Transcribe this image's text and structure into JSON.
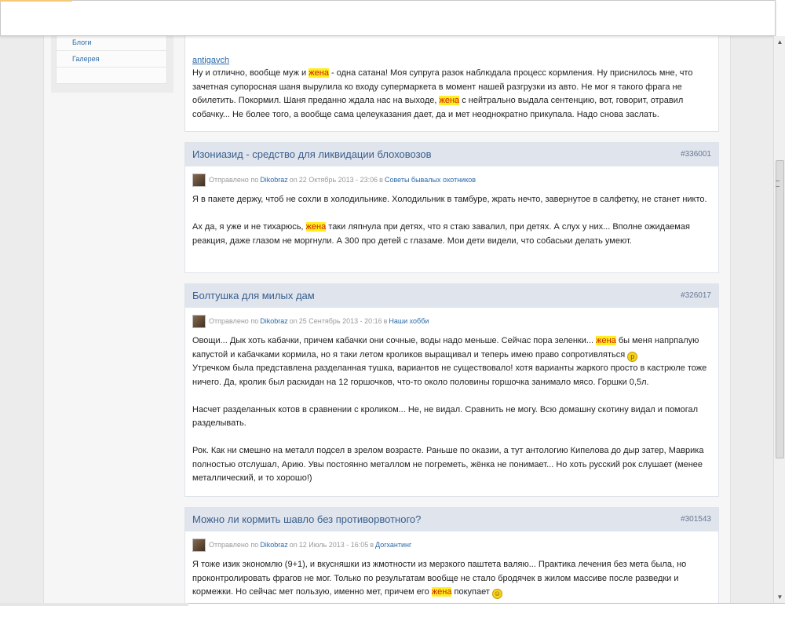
{
  "sidebar": {
    "items": [
      {
        "label": "Блоги"
      },
      {
        "label": "Галерея"
      }
    ]
  },
  "previous_post": {
    "author": "antigavch",
    "text_parts": [
      "Ну и отлично, вообще муж и ",
      "жена",
      " - одна сатана! Моя супруга разок наблюдала процесс кормления. Ну приснилось мне, что зачетная супоросная шаня вырулила ко входу супермаркета в момент нашей разгрузки из авто. Не мог я такого фрага не обилетить. Покормил. Шаня преданно ждала нас на выходе, ",
      "жена",
      " с нейтрально выдала сентенцию, вот, говорит, отравил собачку... Не более того, а вообще сама целеуказания дает, да и мет неоднократно прикупала. Надо снова заслать."
    ]
  },
  "posts": [
    {
      "title": "Изониазид - средство для ликвидации блоховозов",
      "id": "#336001",
      "meta_sent": "Отправлено по",
      "author": "Dikobraz",
      "meta_on": "on",
      "date": "22 Октябрь 2013 - 23:06",
      "meta_in": "в",
      "forum": "Советы бывалых охотников",
      "p1": "Я в пакете держу, чтоб не сохли в холодильнике. Холодильник в тамбуре, жрать нечто, завернутое в салфетку, не станет никто.",
      "p2_a": "Ах да, я уже и не тихарюсь, ",
      "p2_hl": "жена",
      "p2_b": " таки ляпнула при детях, что я стаю завалил, при детях. А слух у них... Вполне ожидаемая реакция, даже глазом не моргнули. А 300 про детей с глазаме. Мои дети  видели, что собаськи делать умеют."
    },
    {
      "title": "Болтушка для милых дам",
      "id": "#326017",
      "meta_sent": "Отправлено по",
      "author": "Dikobraz",
      "meta_on": "on",
      "date": "25 Сентябрь 2013 - 20:16",
      "meta_in": "в",
      "forum": "Наши хобби",
      "p1_a": "Овощи... Дык хоть кабачки, причем кабачки они сочные, воды надо меньше. Сейчас пора зеленки... ",
      "p1_hl": "жена",
      "p1_b": " бы меня напрпалую капустой и кабачками кормила, но я таки летом кроликов выращивал и теперь имею право сопротивляться ",
      "p1_c": "Утречком была представлена разделанная тушка, вариантов не существовало! хотя варианты жаркого просто в кастрюле тоже ничего. Да, кролик был раскидан на 12 горшочков, что-то около половины горшочка занимало мясо. Горшки 0,5л.",
      "p2": "Насчет разделанных котов в сравнении с кроликом... Не, не видал. Сравнить не могу. Всю домашну скотину видал и помогал разделывать.",
      "p3": "Рок. Как ни смешно на металл подсел в зрелом возрасте. Раньше по оказии, а тут антологию Кипелова до дыр затер, Маврика полностью отслушал, Арию. Увы постоянно металлом не погреметь, жёнка не понимает... Но хоть русский рок слушает (менее металлический, и то хорошо!)"
    },
    {
      "title": "Можно ли кормить шавло без противорвотного?",
      "id": "#301543",
      "meta_sent": "Отправлено по",
      "author": "Dikobraz",
      "meta_on": "on",
      "date": "12 Июль 2013 - 16:05",
      "meta_in": "в",
      "forum": "Догхантинг",
      "p1_a": "Я тоже изик экономлю (9+1), и вкусняшки из жмотности из мерзкого паштета валяю... Практика лечения без мета была, но проконтролировать фрагов не мог. Только по результатам вообще не стало бродячек в жилом массиве после разведки и кормежки. Но сейчас мет пользую, именно мет, причем его ",
      "p1_hl": "жена",
      "p1_b": " покупает "
    }
  ],
  "icons": {
    "smiley_tongue": "smiley-tongue-icon",
    "smiley": "smiley-icon"
  },
  "colors": {
    "link": "#2a6aa8",
    "title": "#3a5f8c",
    "highlight_bg": "#ffee22",
    "highlight_fg": "#cc2200",
    "header_bg": "#dfe4ed"
  }
}
